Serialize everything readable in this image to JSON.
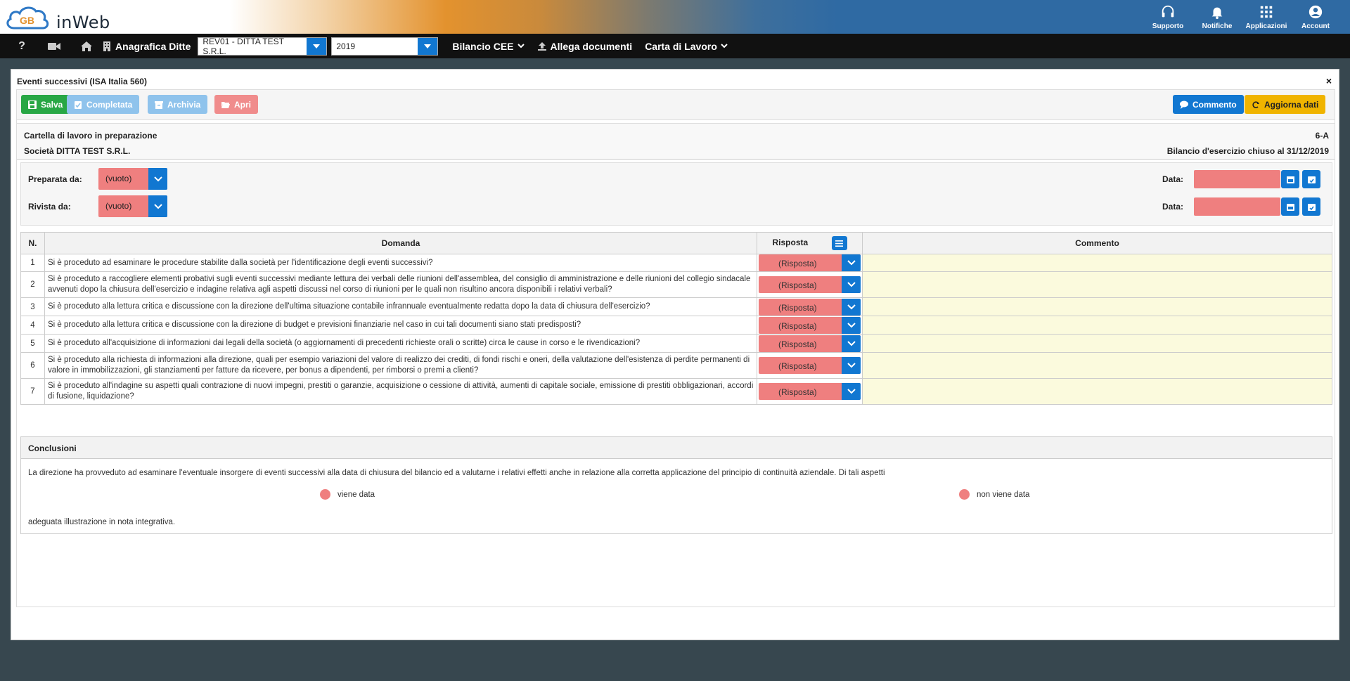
{
  "header": {
    "logo_text": "inWeb",
    "logo_mark": "GB",
    "actions": [
      {
        "label": "Supporto",
        "icon": "headset-icon"
      },
      {
        "label": "Notifiche",
        "icon": "bell-icon"
      },
      {
        "label": "Applicazioni",
        "icon": "grid-icon"
      },
      {
        "label": "Account",
        "icon": "user-circle-icon"
      }
    ]
  },
  "navbar": {
    "help": "?",
    "anagrafica_label": "Anagrafica Ditte",
    "company_value": "REV01 - DITTA TEST S.R.L.",
    "year_value": "2019",
    "bilancio_label": "Bilancio CEE",
    "allega_label": "Allega documenti",
    "carta_label": "Carta di Lavoro"
  },
  "panel": {
    "title": "Eventi successivi (ISA Italia 560)",
    "close": "×",
    "toolbar": {
      "salva": "Salva",
      "completata": "Completata",
      "archivia": "Archivia",
      "apri": "Apri",
      "commento": "Commento",
      "aggiorna": "Aggiorna dati"
    },
    "info": {
      "status": "Cartella di lavoro in preparazione",
      "company": "Società DITTA TEST S.R.L.",
      "code": "6-A",
      "balance": "Bilancio d'esercizio chiuso al 31/12/2019"
    },
    "signatures": {
      "preparata_label": "Preparata da:",
      "preparata_value": "(vuoto)",
      "rivista_label": "Rivista da:",
      "rivista_value": "(vuoto)",
      "data_label": "Data:"
    },
    "table": {
      "headers": {
        "n": "N.",
        "domanda": "Domanda",
        "risposta": "Risposta",
        "commento": "Commento"
      },
      "answer_placeholder": "(Risposta)",
      "rows": [
        {
          "n": "1",
          "q": "Si è proceduto ad esaminare le procedure stabilite dalla società per l'identificazione degli eventi successivi?"
        },
        {
          "n": "2",
          "q": "Si è proceduto a raccogliere elementi probativi sugli eventi successivi mediante lettura dei verbali delle riunioni dell'assemblea, del consiglio di amministrazione e delle riunioni del collegio sindacale avvenuti dopo la chiusura dell'esercizio e indagine relativa agli aspetti discussi nel corso di riunioni per le quali non risultino ancora disponibili i relativi verbali?"
        },
        {
          "n": "3",
          "q": "Si è proceduto alla lettura critica e discussione con la direzione dell'ultima situazione contabile infrannuale eventualmente redatta dopo la data di chiusura dell'esercizio?"
        },
        {
          "n": "4",
          "q": "Si è proceduto alla lettura critica e discussione con la direzione di budget e previsioni finanziarie nel caso in cui tali documenti siano stati predisposti?"
        },
        {
          "n": "5",
          "q": "Si è proceduto all'acquisizione di informazioni dai legali della società (o aggiornamenti di precedenti richieste orali o scritte) circa le cause in corso e le rivendicazioni?"
        },
        {
          "n": "6",
          "q": "Si è proceduto alla richiesta di informazioni alla direzione, quali per esempio variazioni del valore di realizzo dei crediti, di fondi rischi e oneri, della valutazione dell'esistenza di perdite permanenti di valore in immobilizzazioni, gli stanziamenti per fatture da ricevere, per bonus a dipendenti, per rimborsi o premi a clienti?"
        },
        {
          "n": "7",
          "q": "Si è proceduto all'indagine su aspetti quali contrazione di nuovi impegni, prestiti o garanzie, acquisizione o cessione di attività, aumenti di capitale sociale, emissione di prestiti obbligazionari, accordi di fusione, liquidazione?"
        }
      ]
    },
    "conclusioni": {
      "title": "Conclusioni",
      "text": "La direzione ha provveduto ad esaminare l'eventuale insorgere di eventi successivi alla data di chiusura del bilancio ed a valutarne i relativi effetti anche in relazione alla corretta applicazione del principio di continuità aziendale. Di tali aspetti",
      "option_yes": "viene data",
      "option_no": "non viene data",
      "footer": "adeguata illustrazione in nota integrativa."
    }
  },
  "colors": {
    "primary": "#1177d1",
    "success": "#28a745",
    "warning": "#f0b400",
    "danger_soft": "#ef7f7f",
    "comment_bg": "#fbfadd"
  }
}
